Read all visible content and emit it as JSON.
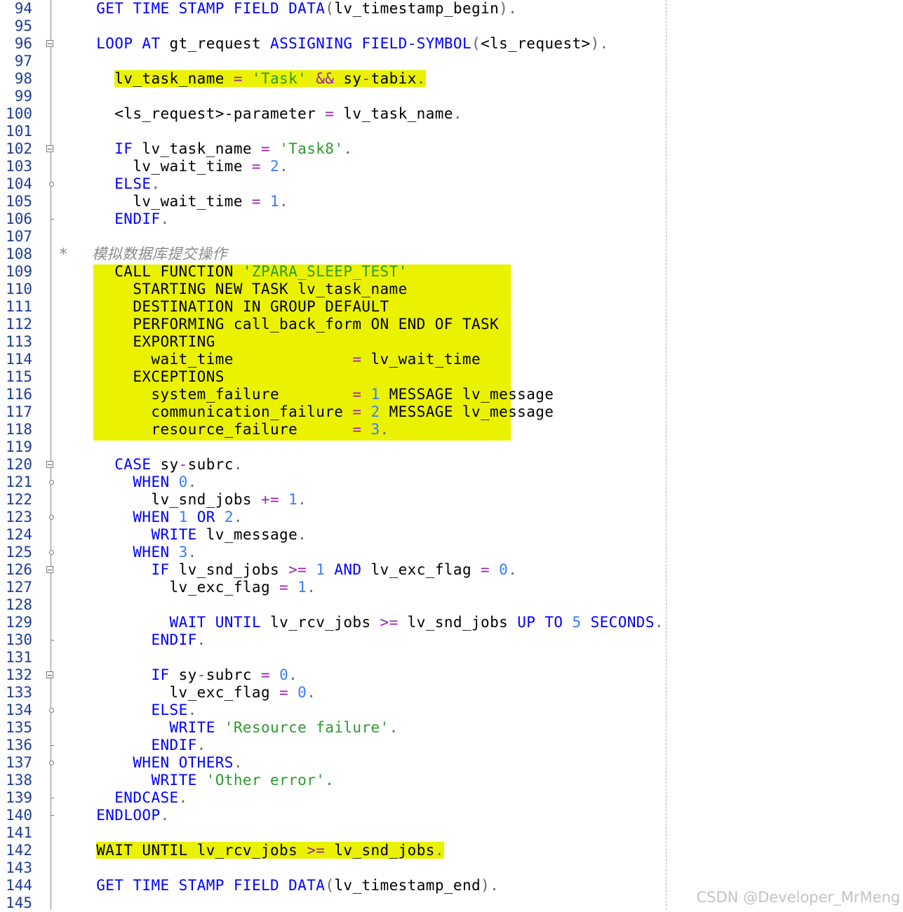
{
  "editor": {
    "lines": [
      {
        "n": "94",
        "text": "    GET TIME STAMP FIELD DATA(lv_timestamp_begin).",
        "marker": "none"
      },
      {
        "n": "95",
        "text": "",
        "marker": "none"
      },
      {
        "n": "96",
        "text": "    LOOP AT gt_request ASSIGNING FIELD-SYMBOL(<ls_request>).",
        "marker": "fold"
      },
      {
        "n": "97",
        "text": "",
        "marker": "none"
      },
      {
        "n": "98",
        "text": "      lv_task_name = 'Task' && sy-tabix.",
        "marker": "none"
      },
      {
        "n": "99",
        "text": "",
        "marker": "none"
      },
      {
        "n": "100",
        "text": "      <ls_request>-parameter = lv_task_name.",
        "marker": "none"
      },
      {
        "n": "101",
        "text": "",
        "marker": "none"
      },
      {
        "n": "102",
        "text": "      IF lv_task_name = 'Task8'.",
        "marker": "fold"
      },
      {
        "n": "103",
        "text": "        lv_wait_time = 2.",
        "marker": "none"
      },
      {
        "n": "104",
        "text": "      ELSE.",
        "marker": "branch"
      },
      {
        "n": "105",
        "text": "        lv_wait_time = 1.",
        "marker": "none"
      },
      {
        "n": "106",
        "text": "      ENDIF.",
        "marker": "end"
      },
      {
        "n": "107",
        "text": "",
        "marker": "none"
      },
      {
        "n": "108",
        "text": "*     模拟数据库提交操作",
        "marker": "none"
      },
      {
        "n": "109",
        "text": "      CALL FUNCTION 'ZPARA_SLEEP_TEST'",
        "marker": "none"
      },
      {
        "n": "110",
        "text": "        STARTING NEW TASK lv_task_name",
        "marker": "none"
      },
      {
        "n": "111",
        "text": "        DESTINATION IN GROUP DEFAULT",
        "marker": "none"
      },
      {
        "n": "112",
        "text": "        PERFORMING call_back_form ON END OF TASK",
        "marker": "none"
      },
      {
        "n": "113",
        "text": "        EXPORTING",
        "marker": "none"
      },
      {
        "n": "114",
        "text": "          wait_time             = lv_wait_time",
        "marker": "none"
      },
      {
        "n": "115",
        "text": "        EXCEPTIONS",
        "marker": "none"
      },
      {
        "n": "116",
        "text": "          system_failure        = 1 MESSAGE lv_message",
        "marker": "none"
      },
      {
        "n": "117",
        "text": "          communication_failure = 2 MESSAGE lv_message",
        "marker": "none"
      },
      {
        "n": "118",
        "text": "          resource_failure      = 3.",
        "marker": "none"
      },
      {
        "n": "119",
        "text": "",
        "marker": "none"
      },
      {
        "n": "120",
        "text": "      CASE sy-subrc.",
        "marker": "fold"
      },
      {
        "n": "121",
        "text": "        WHEN 0.",
        "marker": "branch"
      },
      {
        "n": "122",
        "text": "          lv_snd_jobs += 1.",
        "marker": "none"
      },
      {
        "n": "123",
        "text": "        WHEN 1 OR 2.",
        "marker": "branch"
      },
      {
        "n": "124",
        "text": "          WRITE lv_message.",
        "marker": "none"
      },
      {
        "n": "125",
        "text": "        WHEN 3.",
        "marker": "branch"
      },
      {
        "n": "126",
        "text": "          IF lv_snd_jobs >= 1 AND lv_exc_flag = 0.",
        "marker": "fold"
      },
      {
        "n": "127",
        "text": "            lv_exc_flag = 1.",
        "marker": "none"
      },
      {
        "n": "128",
        "text": "",
        "marker": "none"
      },
      {
        "n": "129",
        "text": "            WAIT UNTIL lv_rcv_jobs >= lv_snd_jobs UP TO 5 SECONDS.",
        "marker": "none"
      },
      {
        "n": "130",
        "text": "          ENDIF.",
        "marker": "end"
      },
      {
        "n": "131",
        "text": "",
        "marker": "none"
      },
      {
        "n": "132",
        "text": "          IF sy-subrc = 0.",
        "marker": "fold"
      },
      {
        "n": "133",
        "text": "            lv_exc_flag = 0.",
        "marker": "none"
      },
      {
        "n": "134",
        "text": "          ELSE.",
        "marker": "branch"
      },
      {
        "n": "135",
        "text": "            WRITE 'Resource failure'.",
        "marker": "none"
      },
      {
        "n": "136",
        "text": "          ENDIF.",
        "marker": "end"
      },
      {
        "n": "137",
        "text": "        WHEN OTHERS.",
        "marker": "branch"
      },
      {
        "n": "138",
        "text": "          WRITE 'Other error'.",
        "marker": "none"
      },
      {
        "n": "139",
        "text": "      ENDCASE.",
        "marker": "end"
      },
      {
        "n": "140",
        "text": "    ENDLOOP.",
        "marker": "end"
      },
      {
        "n": "141",
        "text": "",
        "marker": "none"
      },
      {
        "n": "142",
        "text": "    WAIT UNTIL lv_rcv_jobs >= lv_snd_jobs.",
        "marker": "none"
      },
      {
        "n": "143",
        "text": "",
        "marker": "none"
      },
      {
        "n": "144",
        "text": "    GET TIME STAMP FIELD DATA(lv_timestamp_end).",
        "marker": "none"
      },
      {
        "n": "145",
        "text": "",
        "marker": "none"
      }
    ]
  },
  "watermark": "CSDN @Developer_MrMeng",
  "colors": {
    "keyword": "#0000ff",
    "string": "#2e9a2e",
    "number": "#3a7bff",
    "operator": "#9b1fb5",
    "comment": "#8a8a8a",
    "highlight": "#eaf200",
    "line_number": "#1e3c96"
  }
}
